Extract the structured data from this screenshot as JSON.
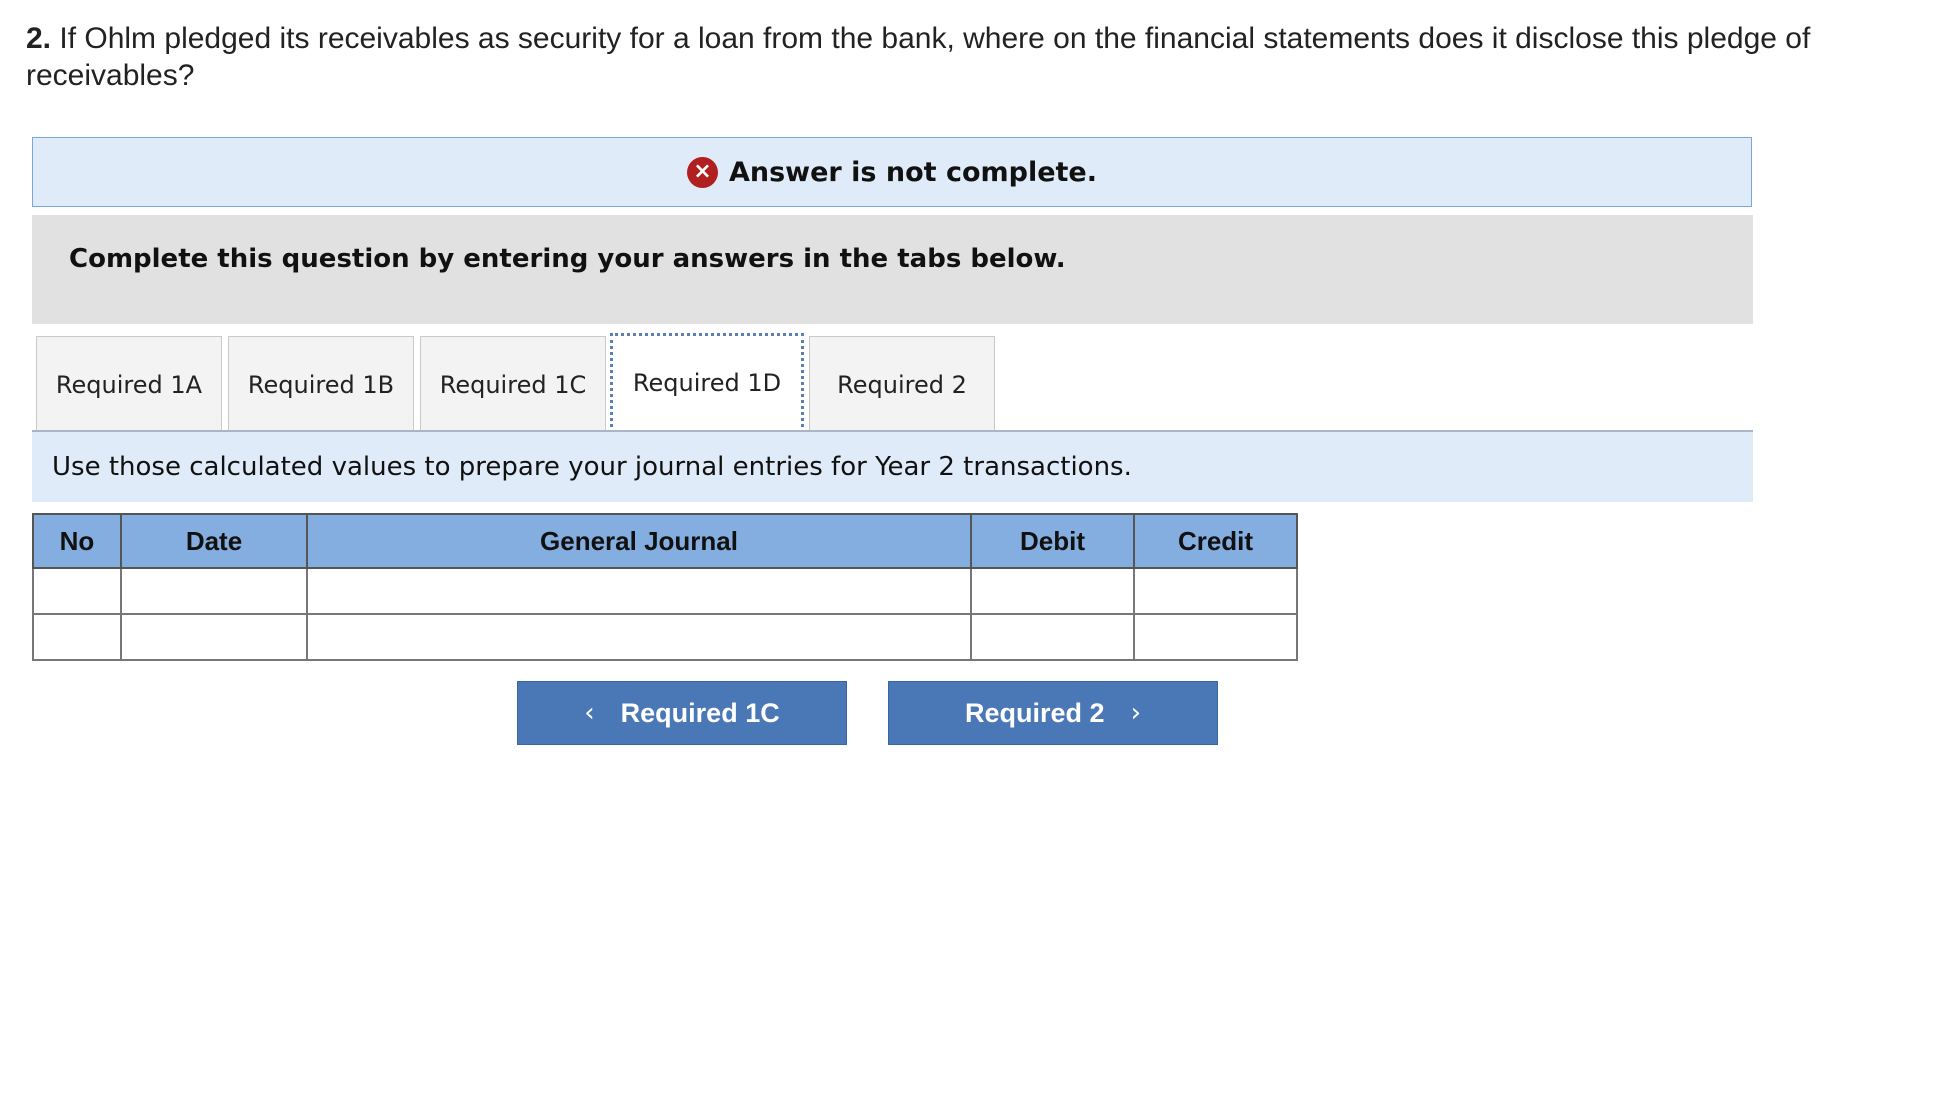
{
  "question": {
    "number": "2.",
    "text": " If Ohlm pledged its receivables as security for a loan from the bank, where on the financial statements does it disclose this pledge of receivables?"
  },
  "status": {
    "icon": "close-circle-icon",
    "icon_glyph": "×",
    "text": "Answer is not complete."
  },
  "instruction": "Complete this question by entering your answers in the tabs below.",
  "tabs": [
    {
      "label": "Required 1A"
    },
    {
      "label": "Required 1B"
    },
    {
      "label": "Required 1C"
    },
    {
      "label": "Required 1D"
    },
    {
      "label": "Required 2"
    }
  ],
  "active_tab": "Required 1D",
  "info_text": "Use those calculated values to prepare your journal entries for Year 2 transactions.",
  "journal": {
    "columns": [
      "No",
      "Date",
      "General Journal",
      "Debit",
      "Credit"
    ],
    "rows": [
      {
        "no": "",
        "date": "",
        "entry": "",
        "debit": "",
        "credit": ""
      },
      {
        "no": "",
        "date": "",
        "entry": "",
        "debit": "",
        "credit": ""
      }
    ]
  },
  "navigation": {
    "prev_label": "Required 1C",
    "prev_glyph": "‹",
    "next_label": "Required 2",
    "next_glyph": "›"
  },
  "colors": {
    "banner_bg": "#dfebf8",
    "error_icon": "#b02020",
    "table_header": "#84ade0",
    "nav_button": "#4a78b7"
  }
}
